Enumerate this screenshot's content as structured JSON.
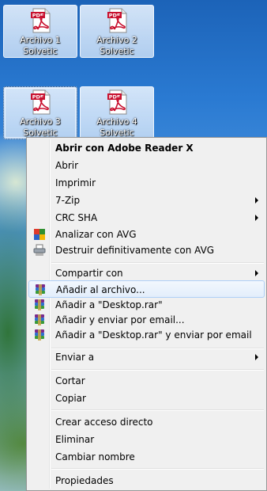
{
  "desktop": {
    "icons": [
      {
        "line1": "Archivo 1",
        "line2": "Solvetic"
      },
      {
        "line1": "Archivo 2",
        "line2": "Solvetic"
      },
      {
        "line1": "Archivo 3",
        "line2": "Solvetic"
      },
      {
        "line1": "Archivo 4",
        "line2": "Solvetic"
      }
    ]
  },
  "menu": {
    "open_with_reader": "Abrir con Adobe Reader X",
    "open": "Abrir",
    "print": "Imprimir",
    "sevenzip": "7-Zip",
    "crc_sha": "CRC SHA",
    "scan_avg": "Analizar con AVG",
    "shred_avg": "Destruir definitivamente con AVG",
    "share_with": "Compartir con",
    "add_to_archive": "Añadir al archivo...",
    "add_to_desktop_rar": "Añadir a \"Desktop.rar\"",
    "add_and_email": "Añadir y enviar por email...",
    "add_desktop_rar_email": "Añadir a \"Desktop.rar\" y enviar por email",
    "send_to": "Enviar a",
    "cut": "Cortar",
    "copy": "Copiar",
    "create_shortcut": "Crear acceso directo",
    "delete": "Eliminar",
    "rename": "Cambiar nombre",
    "properties": "Propiedades"
  }
}
